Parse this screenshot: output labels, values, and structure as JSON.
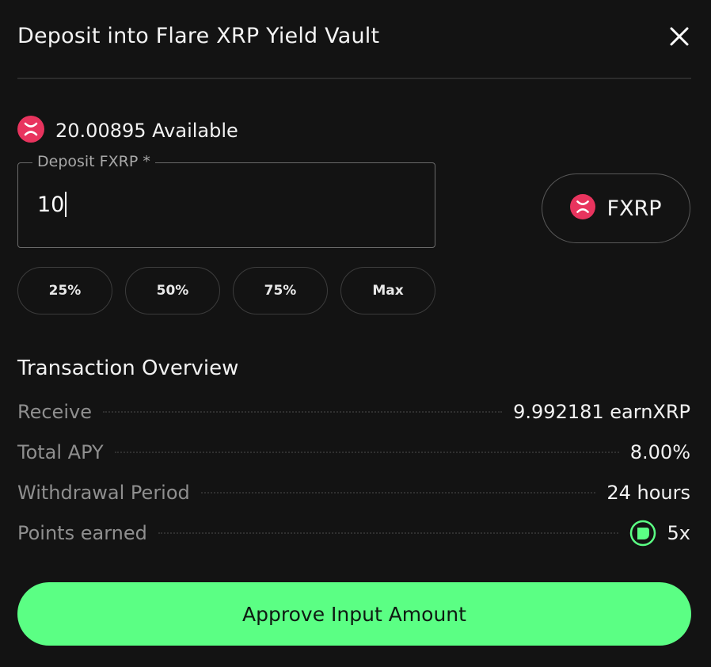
{
  "header": {
    "title": "Deposit into Flare XRP Yield Vault",
    "close_icon": "close-icon"
  },
  "balance": {
    "text": "20.00895 Available",
    "token_icon": "fxrp-token-icon"
  },
  "deposit": {
    "label": "Deposit FXRP *",
    "value": "10"
  },
  "token_select": {
    "label": "FXRP",
    "icon": "fxrp-token-icon"
  },
  "percent_buttons": [
    "25%",
    "50%",
    "75%",
    "Max"
  ],
  "overview": {
    "title": "Transaction Overview",
    "rows": [
      {
        "label": "Receive",
        "value": "9.992181 earnXRP"
      },
      {
        "label": "Total APY",
        "value": "8.00%"
      },
      {
        "label": "Withdrawal Period",
        "value": "24 hours"
      },
      {
        "label": "Points earned",
        "value": "5x",
        "icon": "points-icon"
      }
    ]
  },
  "action": {
    "label": "Approve Input Amount"
  },
  "colors": {
    "accent": "#5bff84",
    "token": "#e8345e",
    "background": "#131313"
  }
}
